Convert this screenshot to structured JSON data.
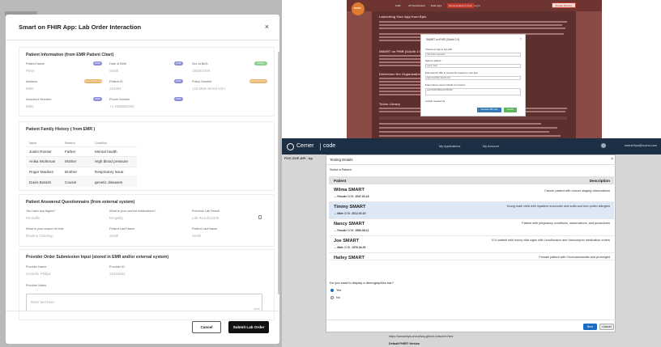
{
  "lab_modal": {
    "title": "Smart on FHIR App: Lab Order Interaction",
    "close": "×",
    "patient_info": {
      "heading": "Patient Information (from EMR Patient Chart)",
      "fields": [
        {
          "label": "Patient Name",
          "value": "Peter",
          "tag": "EMR"
        },
        {
          "label": "Date of Birth",
          "value": "15/09/1978",
          "tag": "EMR"
        },
        {
          "label": "Sex at Birth",
          "value": "Male",
          "tag": "Patient"
        },
        {
          "label": "Address",
          "value": "Male",
          "tag": "External Source"
        },
        {
          "label": "Patient ID",
          "value": "224454",
          "tag": "EMR"
        },
        {
          "label": "Policy Number",
          "value": "123 Main Street USA",
          "tag": "External Source"
        },
        {
          "label": "Insurance Number",
          "value": "Male",
          "tag": "EMR"
        },
        {
          "label": "Phone Number",
          "value": "+1 2299962469",
          "tag": "EMR"
        }
      ],
      "extra_value": "Smith"
    },
    "family_history": {
      "heading": "Patient Family History ( from EMR )",
      "columns": [
        "Name",
        "Relation",
        "Condition"
      ],
      "rows": [
        [
          "Justin Rosser",
          "Father",
          "Mental health"
        ],
        [
          "Anika Workman",
          "Mother",
          "High blood pressure"
        ],
        [
          "Roger Madsen",
          "Brother",
          "Respiratory issue"
        ],
        [
          "Davis Botosh",
          "Cousin",
          "genetic diseases"
        ]
      ]
    },
    "questionnaire": {
      "heading": "Patient Answered Questionnaire (from external system)",
      "fields": [
        {
          "label": "You have any Algies?",
          "value": "Penicillin"
        },
        {
          "label": "What is your current medications?",
          "value": "Emgality"
        },
        {
          "label": "Previous Lab Result",
          "value": "Lab Result12445"
        },
        {
          "label": "What is your reason for test",
          "value": "Routine Checkup"
        },
        {
          "label": "Patient Last Name",
          "value": "Smith"
        },
        {
          "label": "Patient Last Name",
          "value": "Smith"
        }
      ]
    },
    "provider": {
      "heading": "Provider Order Submission Input (stored in EMR and/or external system)",
      "fields": [
        {
          "label": "Provider Name",
          "value": "Cristofer Philips"
        },
        {
          "label": "Provider ID",
          "value": "22444554"
        }
      ],
      "notes_label": "Provider Notes",
      "notes_placeholder": "Enter text here",
      "notes_counter": "0/150"
    },
    "cancel": "Cancel",
    "submit": "Submit Lab Order"
  },
  "launch_page": {
    "nav": [
      "FHIR",
      "API Specification",
      "Build Apps",
      "Documentation & Tools",
      "Log In"
    ],
    "nav_button": "Provider Directory",
    "logo": "OPEN",
    "headings": [
      "Launching Your App from Epic",
      "SMART on FHIR (OAuth 2.0)",
      "Determine the Organization",
      "Token Library"
    ],
    "dialog": {
      "title": "SMART on FHIR (OAuth 2.0)",
      "close": "×",
      "app_label": "Choose an app to test with:",
      "app_value": "Lab Order Interaction",
      "patient_label": "Select a patient:",
      "patient_value": "Lopez, Jose",
      "launch_label": "Enter launch URL to receive the request to your app:",
      "launch_value": "https://sandbox.launch.com",
      "token_label": "Enter tokens used in OAuth 2.0 context:",
      "token_value": "aud=%3D%7Bfhirurl%7D%26",
      "check_label": "Include required iss",
      "btn_generate": "Generate URL Only",
      "btn_launch": "Launch"
    }
  },
  "cerner": {
    "brand": "Cerner",
    "code": "code",
    "nav": [
      "My Applications",
      "My Account"
    ],
    "user": "samarthya@sucha.com",
    "subheader": "POC-SOF-API - Ap",
    "dialog": {
      "title": "Testing Details",
      "close": "×",
      "select": "Select a Patient:",
      "col_patient": "Patient",
      "col_desc": "Description",
      "patients": [
        {
          "name": "Wilma SMART",
          "sex": "Female",
          "dob": "1947-03-16",
          "desc": "Cancer patient with cancer staging observations"
        },
        {
          "name": "Timmy SMART",
          "sex": "Male",
          "dob": "2012-02-19",
          "desc": "Young male child with inpatient encounter and sulfa and tree pollen allergies"
        },
        {
          "name": "Nancy SMART",
          "sex": "Female",
          "dob": "1980-08-11",
          "desc": "Patient with pregnancy conditions, observations, and procedures"
        },
        {
          "name": "Joe SMART",
          "sex": "Male",
          "dob": "1976-04-29",
          "desc": "ICU patient with hourly vital signs with Levofloxacin and Vancomycin medication orders"
        },
        {
          "name": "Hailey SMART",
          "sex": "Female",
          "dob": "",
          "desc": "Female patient with Chorioamnionitis and prolonged"
        }
      ],
      "question": "Do you want to display a demographics bar?",
      "yes": "Yes",
      "no": "No",
      "next": "Next",
      "cancel": "Cancel"
    },
    "launch_url": "https://samarthya-choudhary.github.io/launch.html",
    "fhir_version": "Default FHIR® Version"
  },
  "colors": {
    "emr_tag": "#8c8ed6",
    "external_tag": "#e9b36a",
    "patient_tag": "#8ccf8c",
    "cerner_nav": "#1d2f45",
    "selected_row": "#dce8f5"
  }
}
